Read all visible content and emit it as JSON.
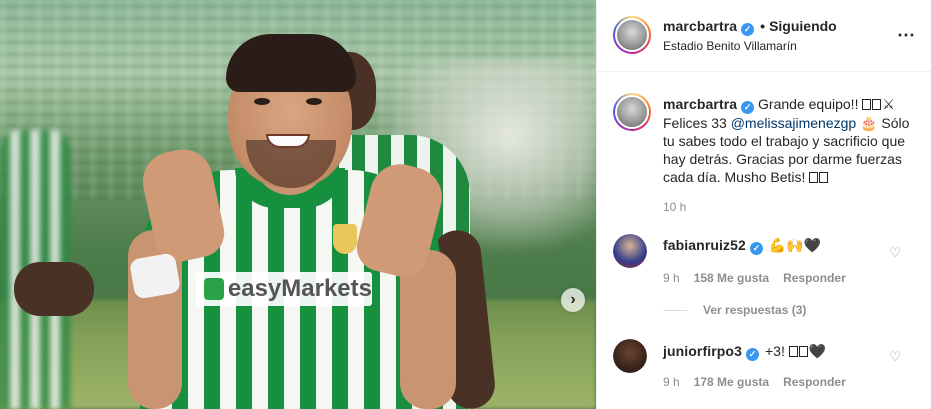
{
  "post": {
    "author": "marcbartra",
    "follow_status": "Siguiendo",
    "separator": "•",
    "location": "Estadio Benito Villamarín",
    "more_icon": "⋯",
    "photo": {
      "sponsor_text": "easyMarkets",
      "next_icon": "›"
    },
    "caption": {
      "username": "marcbartra",
      "text_1": "Grande equipo!! ",
      "emoji_1": "⚔",
      "text_2": "Felices 33 ",
      "mention": "@melissajimenezgp",
      "emoji_2": " 🎂 ",
      "text_3": "Sólo tu sabes todo el trabajo y sacrificio que hay detrás. Gracias por darme fuerzas cada día. Musho Betis! "
    },
    "time_ago": "10 h"
  },
  "comments": [
    {
      "username": "fabianruiz52",
      "text": "💪🙌🖤",
      "time": "9 h",
      "likes": "158 Me gusta",
      "reply_label": "Responder",
      "view_replies": "Ver respuestas (3)",
      "like_icon": "♡"
    },
    {
      "username": "juniorfirpo3",
      "text": "+3! ",
      "text_emoji": "🖤",
      "time": "9 h",
      "likes": "178 Me gusta",
      "reply_label": "Responder",
      "like_icon": "♡"
    }
  ],
  "icons": {
    "verified": "✓",
    "author_avatar": "avatar-icon",
    "like": "heart-icon",
    "more": "more-options-icon",
    "next": "chevron-right-icon"
  },
  "colors": {
    "verified_blue": "#3897f0",
    "mention_blue": "#00376b",
    "muted_text": "#8e8e8e",
    "betis_green": "#16903e"
  }
}
